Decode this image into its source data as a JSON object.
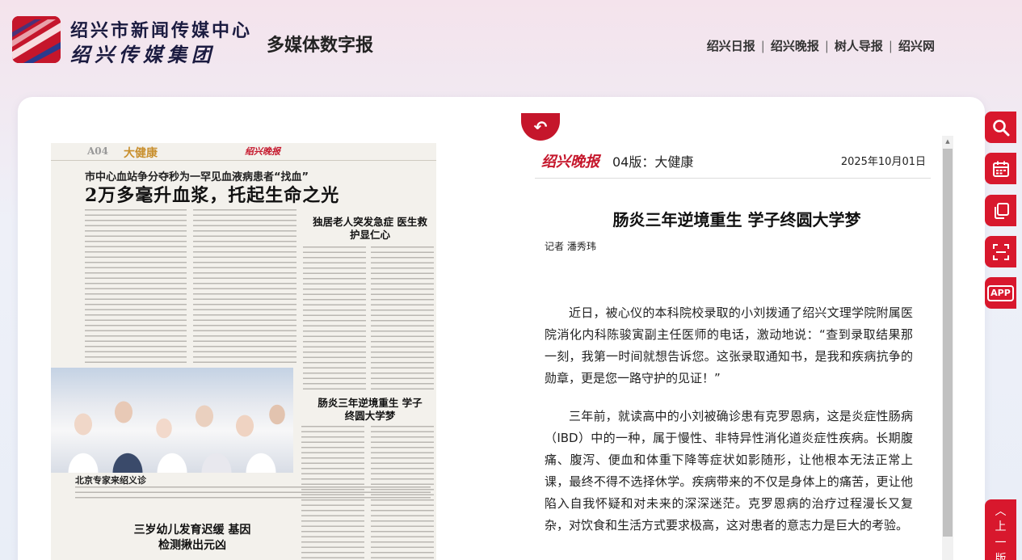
{
  "header": {
    "org_name": "绍兴市新闻传媒中心",
    "group_name": "绍兴传媒集团",
    "subtitle": "多媒体数字报",
    "links": [
      {
        "label": "绍兴日报"
      },
      {
        "label": "绍兴晚报"
      },
      {
        "label": "树人导报"
      },
      {
        "label": "绍兴网"
      }
    ],
    "separator": "|"
  },
  "newspaper_page": {
    "page_number": "A04",
    "section": "大健康",
    "masthead": "绍兴晚报",
    "kicker": "市中心血站争分夺秒为一罕见血液病患者“找血”",
    "headline": "2万多毫升血浆，托起生命之光",
    "side_head_1": "独居老人突发急症 医生救护显仁心",
    "side_head_2": "肠炎三年逆境重生 学子终圆大学梦",
    "photo_caption_head": "北京专家来绍义诊",
    "bottom_head": "三岁幼儿发育迟缓 基因检测揪出元凶"
  },
  "article": {
    "masthead": "绍兴晚报",
    "edition": "04版：大健康",
    "date": "2025年10月01日",
    "title": "肠炎三年逆境重生 学子终圆大学梦",
    "author": "记者 潘秀玮",
    "paragraphs": [
      "近日，被心仪的本科院校录取的小刘拨通了绍兴文理学院附属医院消化内科陈骏寅副主任医师的电话，激动地说：“查到录取结果那一刻，我第一时间就想告诉您。这张录取通知书，是我和疾病抗争的勋章，更是您一路守护的见证！”",
      "三年前，就读高中的小刘被确诊患有克罗恩病，这是炎症性肠病（IBD）中的一种，属于慢性、非特异性消化道炎症性疾病。长期腹痛、腹泻、便血和体重下降等症状如影随形，让他根本无法正常上课，最终不得不选择休学。疾病带来的不仅是身体上的痛苦，更让他陷入自我怀疑和对未来的深深迷茫。克罗恩病的治疗过程漫长又复杂，对饮食和生活方式要求极高，这对患者的意志力是巨大的考验。"
    ]
  },
  "toolbar": {
    "icons": [
      "search-icon",
      "calendar-icon",
      "copy-icon",
      "scan-icon",
      "app-icon"
    ],
    "app_label": "APP",
    "back_top_label": "上一版"
  },
  "colors": {
    "brand_red": "#c5162b",
    "toolbar_red": "#d8182d"
  }
}
